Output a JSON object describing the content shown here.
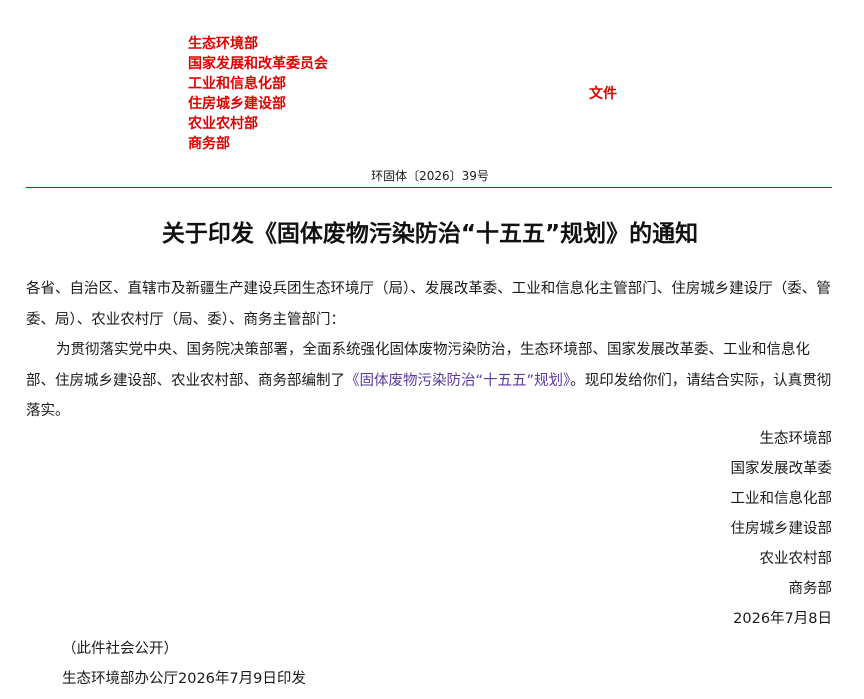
{
  "header": {
    "agencies": [
      "生态环境部",
      "国家发展和改革委员会",
      "工业和信息化部",
      "住房城乡建设部",
      "农业农村部",
      "商务部"
    ],
    "file_label": "文件",
    "doc_number": "环固体〔2026〕39号",
    "accent_color": "#e00000"
  },
  "title": "关于印发《固体废物污染防治“十五五”规划》的通知",
  "body": {
    "addressees": "各省、自治区、直辖市及新疆生产建设兵团生态环境厅（局）、发展改革委、工业和信息化主管部门、住房城乡建设厅（委、管委、局）、农业农村厅（局、委）、商务主管部门：",
    "para_before_link": "为贯彻落实党中央、国务院决策部署，全面系统强化固体废物污染防治，生态环境部、国家发展改革委、工业和信息化部、住房城乡建设部、农业农村部、商务部编制了",
    "link_text": "《固体废物污染防治“十五五”规划》",
    "para_after_link": "。现印发给你们，请结合实际，认真贯彻落实。"
  },
  "signatories": [
    "生态环境部",
    "国家发展改革委",
    "工业和信息化部",
    "住房城乡建设部",
    "农业农村部",
    "商务部"
  ],
  "date": "2026年7月8日",
  "disclosure": "（此件社会公开）",
  "print_note": "生态环境部办公厅2026年7月9日印发"
}
